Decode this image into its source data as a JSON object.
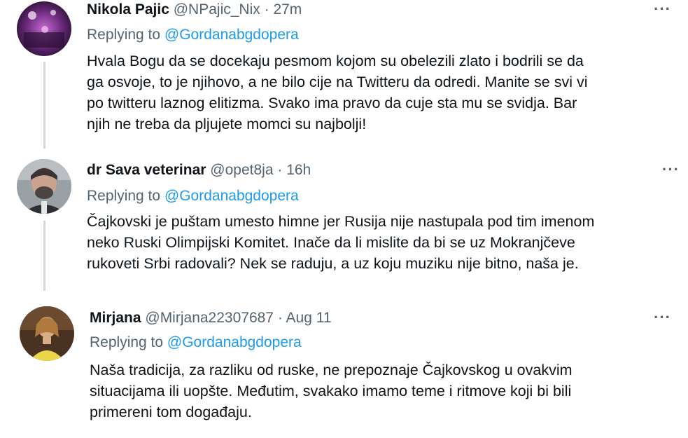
{
  "tweets": [
    {
      "name": "Nikola Pajic",
      "handle": "@NPajic_Nix",
      "separator": "·",
      "time": "27m",
      "reply_prefix": "Replying to",
      "reply_to": "@Gordanabgdopera",
      "lines": [
        "Hvala Bogu da se docekaju pesmom kojom su obelezili zlato i bodrili se da",
        "ga osvoje, to je njihovo, a ne bilo cije na Twitteru da odredi. Manite se svi vi",
        "po twitteru laznog elitizma. Svako ima pravo da cuje sta mu se svidja. Bar",
        "njih ne treba da pljujete momci su najbolji!"
      ],
      "more": "···"
    },
    {
      "name": "dr Sava veterinar",
      "handle": "@opet8ja",
      "separator": "·",
      "time": "16h",
      "reply_prefix": "Replying to",
      "reply_to": "@Gordanabgdopera",
      "lines": [
        "Čajkovski je puštam umesto himne jer Rusija nije nastupala pod tim imenom",
        "neko Ruski Olimpijski Komitet. Inače da li mislite da bi se uz Mokranjčeve",
        "rukoveti Srbi radovali? Nek se raduju, a uz koju muziku nije bitno, naša je."
      ],
      "more": "···"
    },
    {
      "name": "Mirjana",
      "handle": "@Mirjana22307687",
      "separator": "·",
      "time": "Aug 11",
      "reply_prefix": "Replying to",
      "reply_to": "@Gordanabgdopera",
      "lines": [
        "Naša tradicija, za razliku od ruske, ne prepoznaje Čajkovskog u ovakvim",
        "situacijama ili uopšte. Međutim, svakako imamo teme i ritmove koji bi bili",
        "primereni tom događaju."
      ],
      "more": "···"
    }
  ]
}
